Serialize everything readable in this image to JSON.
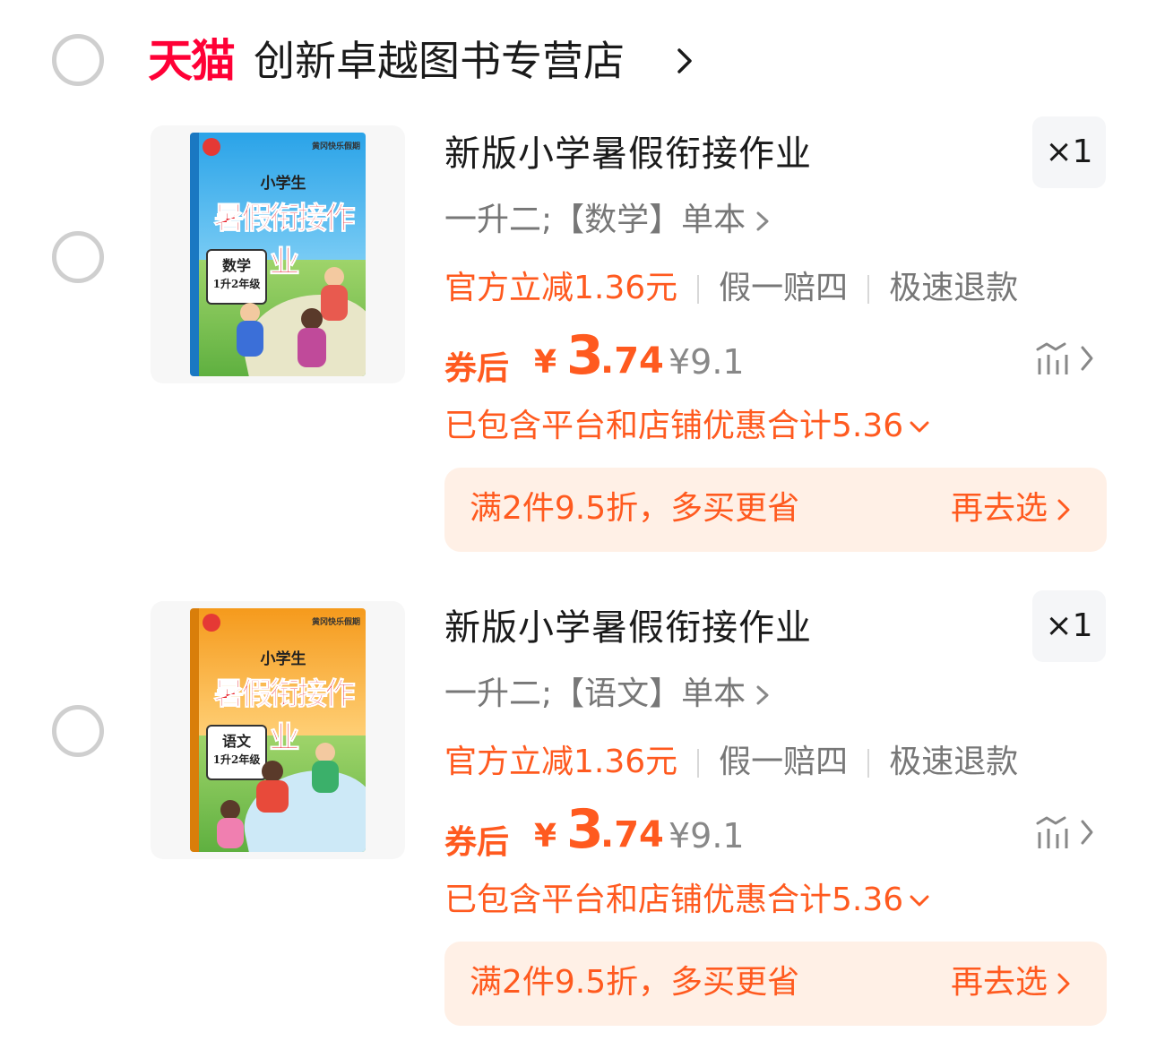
{
  "store": {
    "platform_logo": "天猫",
    "name": "创新卓越图书专营店",
    "accent": "#ff0036"
  },
  "items": [
    {
      "title": "新版小学暑假衔接作业",
      "quantity": "×1",
      "sku": "一升二;【数学】单本",
      "tags": [
        "官方立减1.36元",
        "假一赔四",
        "极速退款"
      ],
      "price_label": "券后",
      "currency": "¥",
      "price_int": "3",
      "price_dec": ".74",
      "original_price": "¥9.1",
      "discount_summary": "已包含平台和店铺优惠合计5.36",
      "promo_text": "满2件9.5折，多买更省",
      "promo_action": "再去选",
      "cover": {
        "series": "黄冈快乐假期",
        "small_title": "小学生",
        "big_title": "暑假衔接作业",
        "subject": "数学",
        "grade": "1升2年级",
        "color": "#2aa3e8"
      }
    },
    {
      "title": "新版小学暑假衔接作业",
      "quantity": "×1",
      "sku": "一升二;【语文】单本",
      "tags": [
        "官方立减1.36元",
        "假一赔四",
        "极速退款"
      ],
      "price_label": "券后",
      "currency": "¥",
      "price_int": "3",
      "price_dec": ".74",
      "original_price": "¥9.1",
      "discount_summary": "已包含平台和店铺优惠合计5.36",
      "promo_text": "满2件9.5折，多买更省",
      "promo_action": "再去选",
      "cover": {
        "series": "黄冈快乐假期",
        "small_title": "小学生",
        "big_title": "暑假衔接作业",
        "subject": "语文",
        "grade": "1升2年级",
        "color": "#f59a1c"
      }
    }
  ],
  "colors": {
    "price": "#ff5a1f",
    "promo_bg": "#fff0e6",
    "muted": "#777777"
  }
}
